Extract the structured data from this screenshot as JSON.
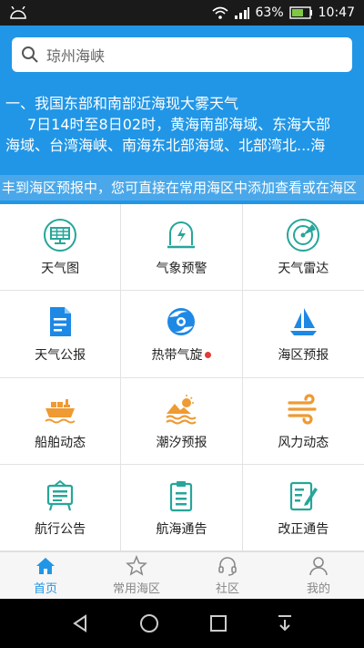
{
  "status": {
    "battery": "63%",
    "time": "10:47"
  },
  "search": {
    "placeholder": "琼州海峡"
  },
  "notice": {
    "line1": "一、我国东部和南部近海现大雾天气",
    "line2": "7日14时至8日02时，黄海南部海域、东海大部",
    "line3": "海域、台湾海峡、南海东北部海域、北部湾北...海"
  },
  "marquee": "丰到海区预报中，您可直接在常用海区中添加查看或在海区",
  "grid": [
    {
      "label": "天气图",
      "icon": "weather-map-icon"
    },
    {
      "label": "气象预警",
      "icon": "weather-alert-icon"
    },
    {
      "label": "天气雷达",
      "icon": "radar-icon"
    },
    {
      "label": "天气公报",
      "icon": "bulletin-icon"
    },
    {
      "label": "热带气旋",
      "icon": "cyclone-icon"
    },
    {
      "label": "海区预报",
      "icon": "sailboat-icon"
    },
    {
      "label": "船舶动态",
      "icon": "ship-icon"
    },
    {
      "label": "潮汐预报",
      "icon": "tide-icon"
    },
    {
      "label": "风力动态",
      "icon": "wind-icon"
    },
    {
      "label": "航行公告",
      "icon": "notice-board-icon"
    },
    {
      "label": "航海通告",
      "icon": "clipboard-icon"
    },
    {
      "label": "改正通告",
      "icon": "edit-doc-icon"
    }
  ],
  "tabs": [
    {
      "label": "首页",
      "icon": "home-icon"
    },
    {
      "label": "常用海区",
      "icon": "star-icon"
    },
    {
      "label": "社区",
      "icon": "headset-icon"
    },
    {
      "label": "我的",
      "icon": "person-icon"
    }
  ],
  "colors": {
    "primary": "#2196e6",
    "teal": "#26a69a",
    "orange": "#ef9a33",
    "red": "#e53935"
  }
}
